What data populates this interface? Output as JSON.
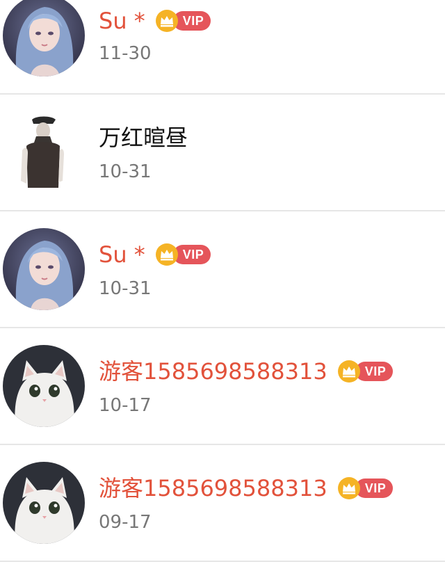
{
  "comments": [
    {
      "name": "Su *",
      "date": "11-30",
      "vip": true,
      "avatar": "anime-girl-blue-hair-avatar",
      "name_color": "#e2523b"
    },
    {
      "name": "万红暄昼",
      "date": "10-31",
      "vip": false,
      "avatar": "man-in-cap-avatar",
      "name_color": "#111111"
    },
    {
      "name": "Su *",
      "date": "10-31",
      "vip": true,
      "avatar": "anime-girl-blue-hair-avatar",
      "name_color": "#e2523b"
    },
    {
      "name": "游客1585698588313",
      "date": "10-17",
      "vip": true,
      "avatar": "white-cat-avatar",
      "name_color": "#e2523b"
    },
    {
      "name": "游客1585698588313",
      "date": "09-17",
      "vip": true,
      "avatar": "white-cat-avatar",
      "name_color": "#e2523b"
    }
  ],
  "vip_label": "VIP",
  "colors": {
    "vip_pill": "#e5555a",
    "crown": "#f5b325",
    "divider": "#e6e6e6",
    "date": "#777777"
  }
}
